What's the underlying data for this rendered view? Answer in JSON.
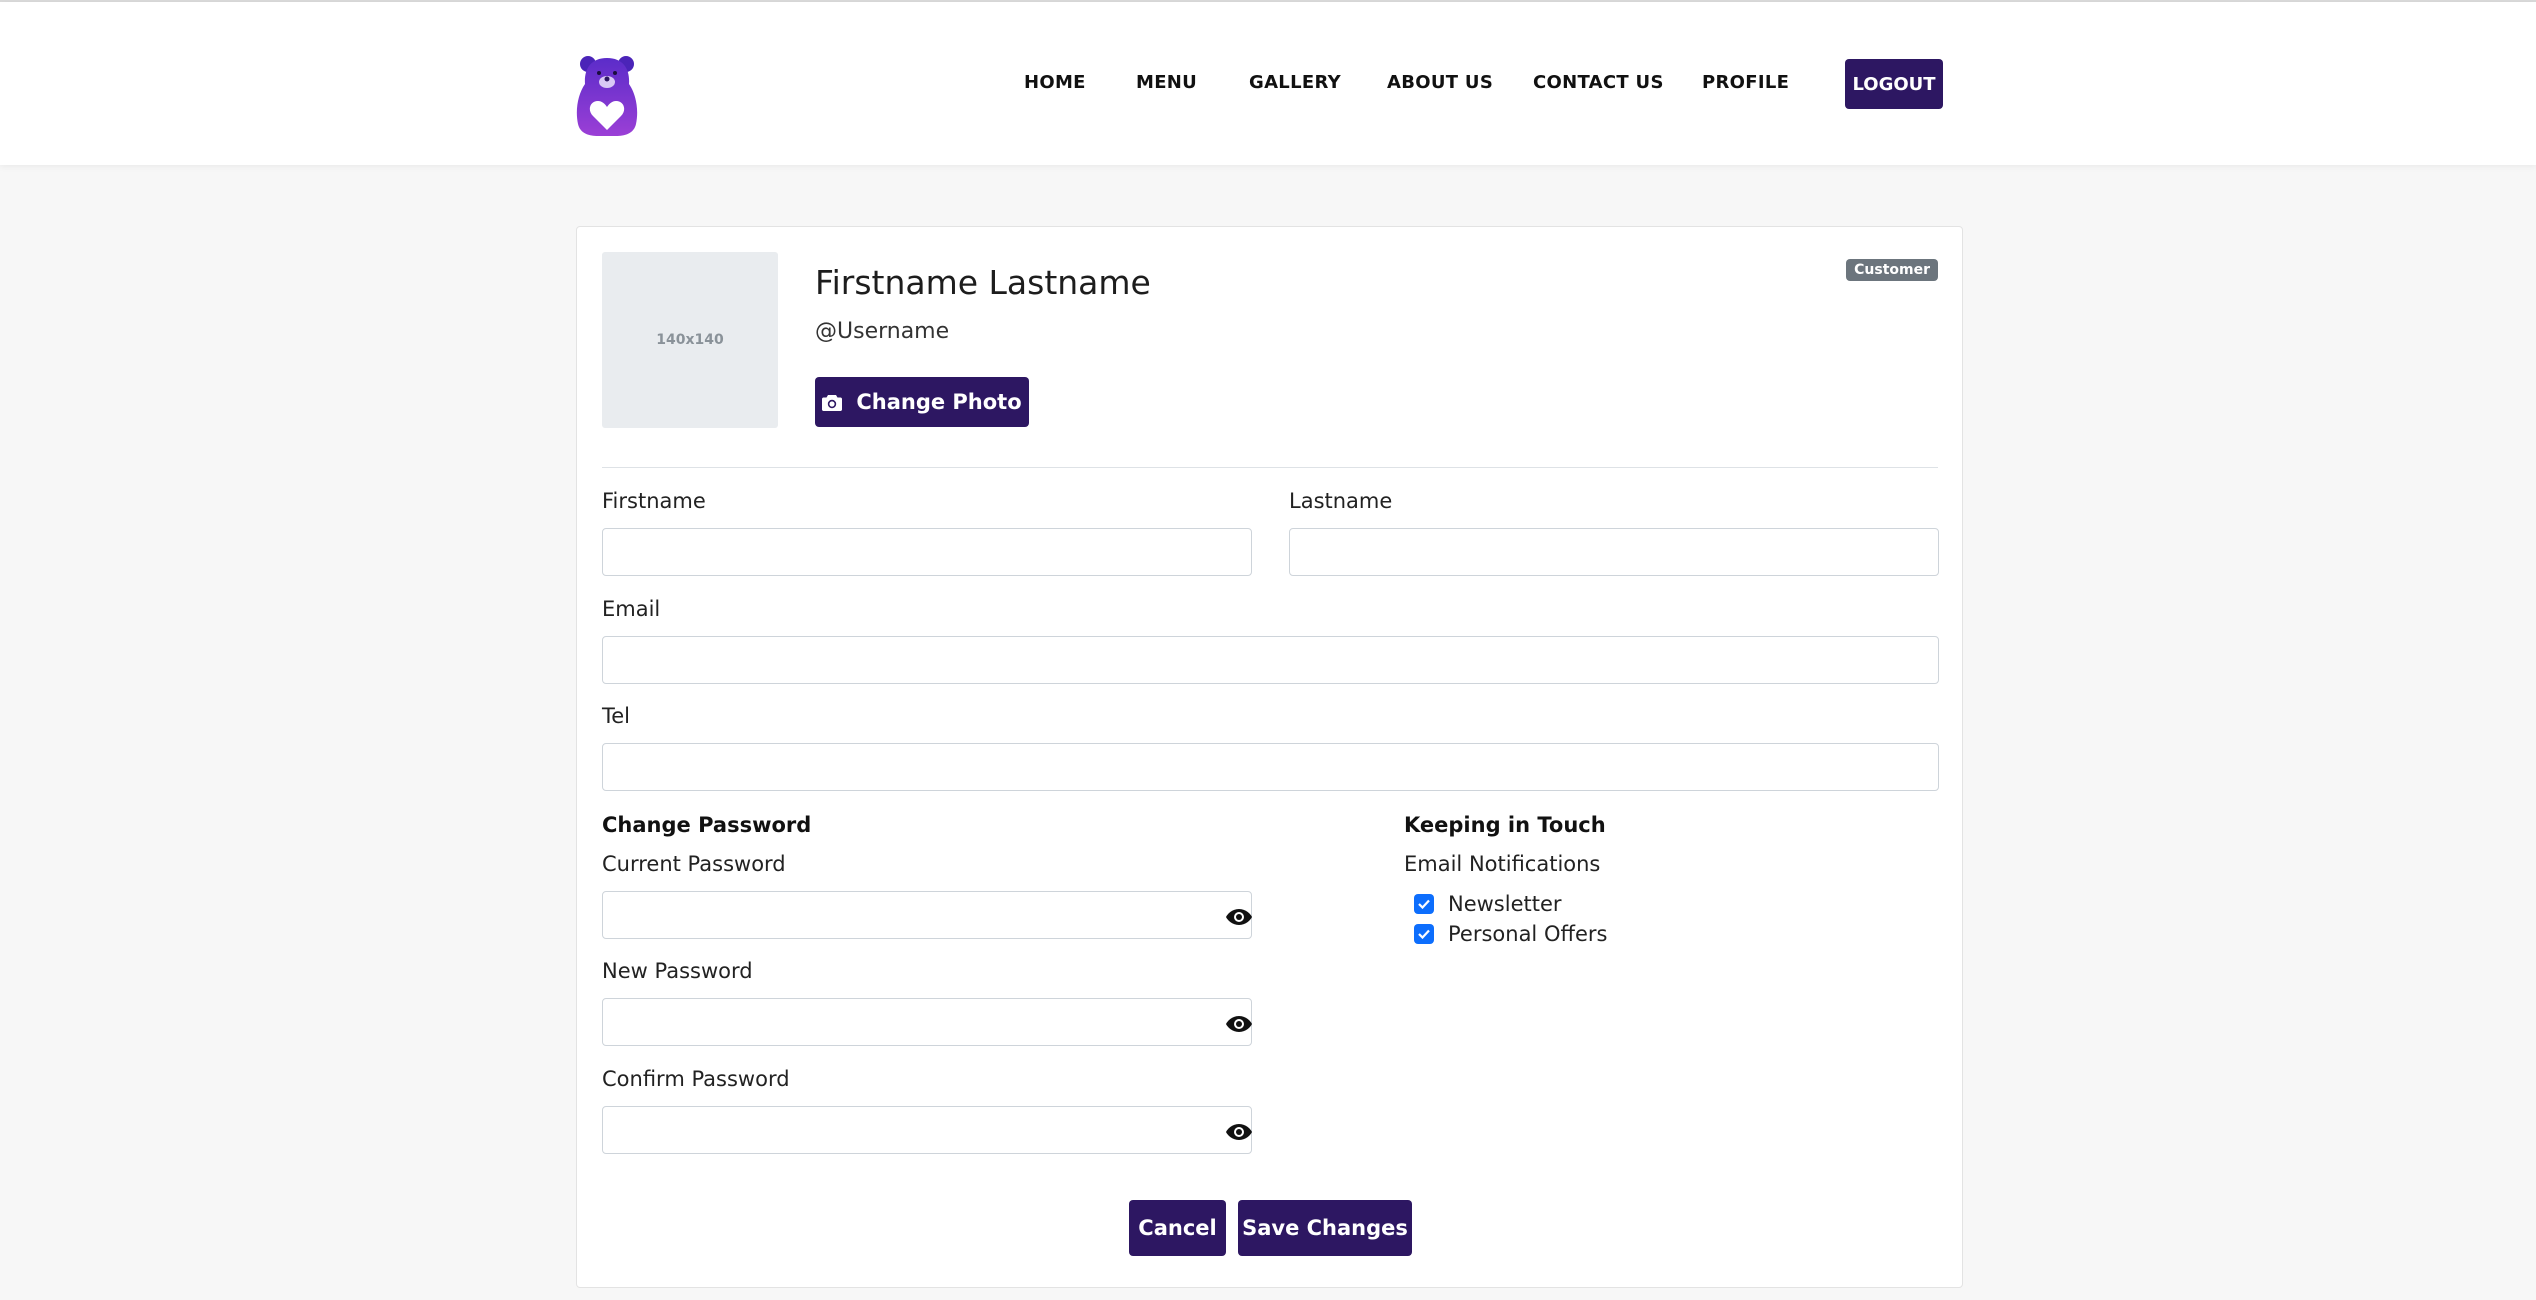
{
  "nav": {
    "links": [
      "HOME",
      "MENU",
      "GALLERY",
      "ABOUT US",
      "CONTACT US",
      "PROFILE"
    ],
    "logout_label": "LOGOUT"
  },
  "profile": {
    "avatar_placeholder": "140x140",
    "full_name": "Firstname Lastname",
    "username": "@Username",
    "change_photo_label": "Change Photo",
    "role_badge": "Customer"
  },
  "form": {
    "firstname_label": "Firstname",
    "firstname_value": "",
    "lastname_label": "Lastname",
    "lastname_value": "",
    "email_label": "Email",
    "email_value": "",
    "tel_label": "Tel",
    "tel_value": ""
  },
  "password": {
    "title": "Change Password",
    "current_label": "Current Password",
    "new_label": "New Password",
    "confirm_label": "Confirm Password"
  },
  "notifications": {
    "title": "Keeping in Touch",
    "subtitle": "Email Notifications",
    "options": [
      {
        "label": "Newsletter",
        "checked": true
      },
      {
        "label": "Personal Offers",
        "checked": true
      }
    ]
  },
  "actions": {
    "cancel_label": "Cancel",
    "save_label": "Save Changes"
  },
  "colors": {
    "brand": "#2d1762",
    "checkbox": "#0d6efd",
    "badge": "#6c757d"
  },
  "icons": {
    "logo": "bear-heart-logo",
    "photo": "camera-icon",
    "password_toggle": "eye-icon",
    "checkbox": "check-icon"
  }
}
